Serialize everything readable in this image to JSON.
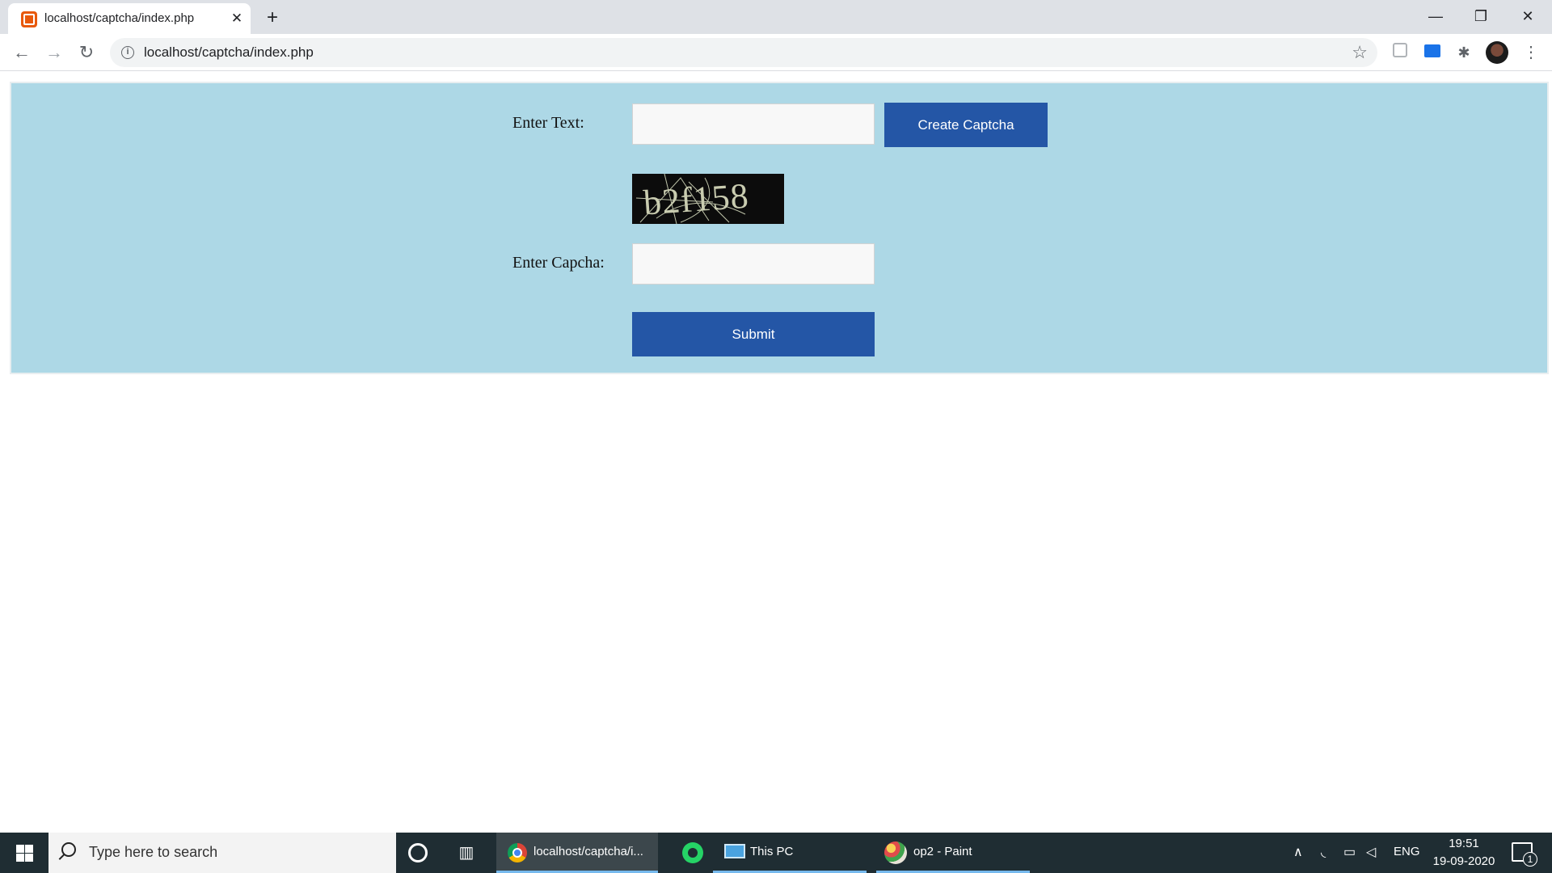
{
  "browser": {
    "tab": {
      "title": "localhost/captcha/index.php",
      "close_label": "✕"
    },
    "new_tab_label": "+",
    "window_controls": {
      "minimize": "—",
      "maximize": "❐",
      "close": "✕"
    },
    "nav": {
      "back": "←",
      "forward": "→",
      "reload": "↻"
    },
    "address_bar": {
      "url": "localhost/captcha/index.php",
      "info_glyph": "i",
      "star_glyph": "☆"
    },
    "extensions": {
      "puzzle_glyph": "✱",
      "menu_glyph": "⋮"
    }
  },
  "form": {
    "text_label": "Enter Text:",
    "text_input_value": "",
    "create_button": "Create Captcha",
    "captcha_image_text": "b2f158",
    "capcha_label": "Enter Capcha:",
    "capcha_input_value": "",
    "submit_button": "Submit"
  },
  "colors": {
    "panel_bg": "#add8e6",
    "button_bg": "#2456a6",
    "button_text": "#ffffff"
  },
  "taskbar": {
    "search_placeholder": "Type here to search",
    "taskview_glyph": "▥",
    "apps": [
      {
        "label": "localhost/captcha/i...",
        "icon": "chrome-icon",
        "active": true
      },
      {
        "label": "",
        "icon": "whatsapp-icon",
        "active": false
      },
      {
        "label": "This PC",
        "icon": "this-pc-icon",
        "active": false
      },
      {
        "label": "op2 - Paint",
        "icon": "paint-icon",
        "active": false
      }
    ],
    "tray": {
      "up_glyph": "∧",
      "wifi_glyph": "◟",
      "battery_glyph": "▭",
      "volume_glyph": "◁",
      "language": "ENG",
      "time": "19:51",
      "date": "19-09-2020",
      "notification_count": "1"
    }
  }
}
